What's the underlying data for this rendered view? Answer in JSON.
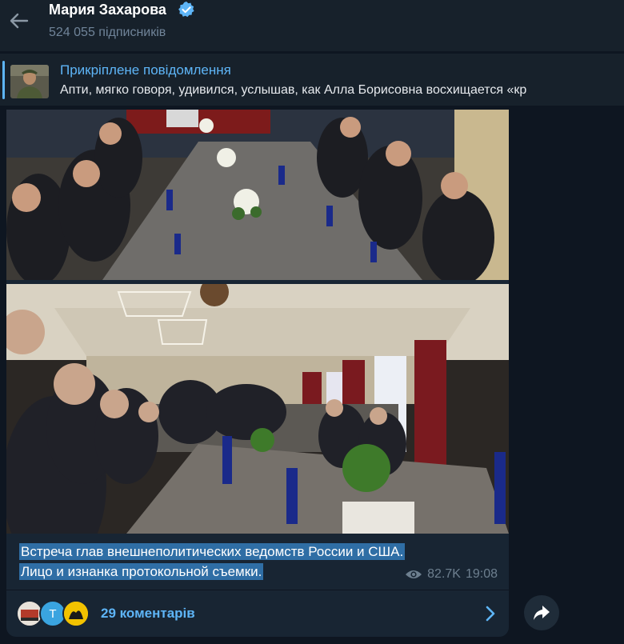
{
  "header": {
    "title": "Мария Захарова",
    "subscribers": "524 055 підписників"
  },
  "pinned": {
    "label": "Прикріплене повідомлення",
    "text": "Апти, мягко говоря, удивился, услышав, как Алла Борисовна восхищается «кр"
  },
  "message": {
    "caption_line1": "Встреча глав внешнеполитических ведомств России и США.",
    "caption_line2": "Лицо и изнанка протокольной съемки.",
    "views": "82.7K",
    "time": "19:08"
  },
  "comments": {
    "label": "29 коментарів",
    "avatar_letter": "T"
  },
  "colors": {
    "accent": "#5eb5f7",
    "bg": "#0e1621",
    "panel": "#17212b",
    "bubble": "#182533",
    "selection": "#2f6ea5"
  },
  "icons": [
    "back-arrow-icon",
    "verified-icon",
    "eye-icon",
    "chevron-right-icon",
    "share-icon"
  ]
}
